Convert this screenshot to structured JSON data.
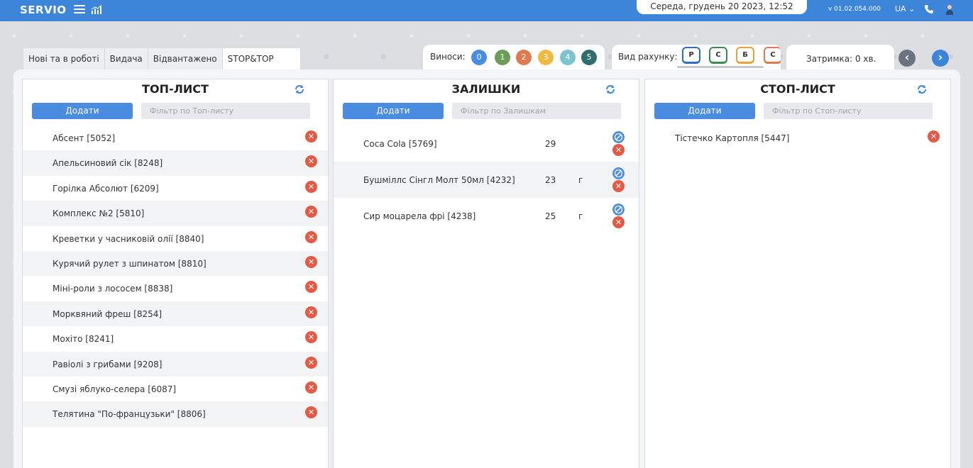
{
  "topbar": {
    "logo": "SERVIO",
    "date": "Середа, грудень 20 2023, 12:52",
    "version": "v 01.02.054.000",
    "lang": "UA",
    "bg_color": "#3d85d8"
  },
  "tabs": [
    {
      "label": "Нові та в роботі"
    },
    {
      "label": "Видача"
    },
    {
      "label": "Відвантажено"
    },
    {
      "label": "STOP&TOP"
    }
  ],
  "vynosy": {
    "label": "Виноси:",
    "items": [
      {
        "label": "0",
        "color": "#4a8de0"
      },
      {
        "label": "1",
        "color": "#6c9d57"
      },
      {
        "label": "2",
        "color": "#e07b4f"
      },
      {
        "label": "3",
        "color": "#f0b941"
      },
      {
        "label": "4",
        "color": "#7dc3cf"
      },
      {
        "label": "5",
        "color": "#2f6e6d"
      }
    ]
  },
  "vid": {
    "label": "Вид рахунку:",
    "items": [
      {
        "label": "Р",
        "color": "#2a6fc1"
      },
      {
        "label": "С",
        "color": "#3b8d4f"
      },
      {
        "label": "Б",
        "color": "#e8a23a"
      },
      {
        "label": "С",
        "color": "#e07b4f"
      }
    ]
  },
  "delay": {
    "label": "Затримка: 0 хв."
  },
  "top_list": {
    "title": "ТОП-ЛИСТ",
    "add_label": "Додати",
    "filter_placeholder": "Фільтр по Топ-листу",
    "items": [
      "Абсент [5052]",
      "Апельсиновий сік [8248]",
      "Горілка Абсолют [6209]",
      "Комплекс №2 [5810]",
      "Креветки у часниковій олії [8840]",
      "Курячий рулет з шпинатом [8810]",
      "Міні-роли з лососем [8838]",
      "Морквяний фреш [8254]",
      "Мохіто [8241]",
      "Равіолі з грибами [9208]",
      "Смузі яблуко-селера [6087]",
      "Телятина \"По-французьки\" [8806]"
    ]
  },
  "remains": {
    "title": "ЗАЛИШКИ",
    "add_label": "Додати",
    "filter_placeholder": "Фільтр по Залишкам",
    "items": [
      {
        "name": "Coca Cola [5769]",
        "qty": "29",
        "unit": ""
      },
      {
        "name": "Бушміллс Сінгл Молт 50мл [4232]",
        "qty": "23",
        "unit": "г"
      },
      {
        "name": "Сир моцарела фрі [4238]",
        "qty": "25",
        "unit": "г"
      }
    ]
  },
  "stop_list": {
    "title": "СТОП-ЛИСТ",
    "add_label": "Додати",
    "filter_placeholder": "Фільтр по Стоп-листу",
    "items": [
      "Тістечко Картопля [5447]"
    ]
  }
}
